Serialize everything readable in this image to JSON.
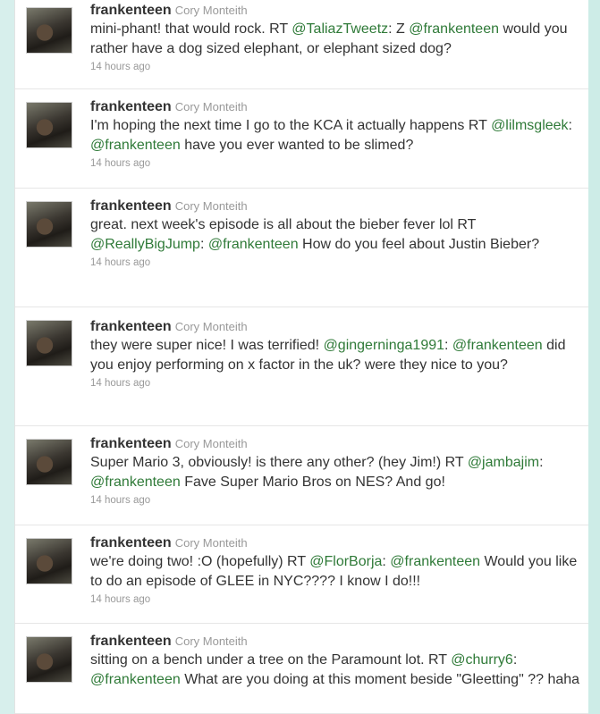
{
  "tweets": [
    {
      "screen_name": "frankenteen",
      "full_name": "Cory Monteith",
      "segments": [
        {
          "t": "mini-phant! that would rock. RT "
        },
        {
          "t": "@TaliazTweetz",
          "link": true
        },
        {
          "t": ": Z "
        },
        {
          "t": "@frankenteen",
          "link": true
        },
        {
          "t": " would you rather have a dog sized elephant, or elephant sized dog?"
        }
      ],
      "timestamp": "14 hours ago"
    },
    {
      "screen_name": "frankenteen",
      "full_name": "Cory Monteith",
      "segments": [
        {
          "t": "I'm hoping the next time I go to the KCA it actually happens RT "
        },
        {
          "t": "@lilmsgleek",
          "link": true
        },
        {
          "t": ": "
        },
        {
          "t": "@frankenteen",
          "link": true
        },
        {
          "t": " have you ever wanted to be slimed?"
        }
      ],
      "timestamp": "14 hours ago"
    },
    {
      "screen_name": "frankenteen",
      "full_name": "Cory Monteith",
      "segments": [
        {
          "t": "great. next week's episode is all about the bieber fever lol RT "
        },
        {
          "t": "@ReallyBigJump",
          "link": true
        },
        {
          "t": ": "
        },
        {
          "t": "@frankenteen",
          "link": true
        },
        {
          "t": " How do you feel about Justin Bieber?"
        }
      ],
      "timestamp": "14 hours ago"
    },
    {
      "screen_name": "frankenteen",
      "full_name": "Cory Monteith",
      "segments": [
        {
          "t": "they were super nice! I was terrified! "
        },
        {
          "t": "@gingerninga1991",
          "link": true
        },
        {
          "t": ": "
        },
        {
          "t": "@frankenteen",
          "link": true
        },
        {
          "t": " did you enjoy performing on x factor in the uk? were they nice to you?"
        }
      ],
      "timestamp": "14 hours ago"
    },
    {
      "screen_name": "frankenteen",
      "full_name": "Cory Monteith",
      "segments": [
        {
          "t": "Super Mario 3, obviously! is there any other? (hey Jim!) RT "
        },
        {
          "t": "@jambajim",
          "link": true
        },
        {
          "t": ": "
        },
        {
          "t": "@frankenteen",
          "link": true
        },
        {
          "t": " Fave Super Mario Bros on NES? And go!"
        }
      ],
      "timestamp": "14 hours ago"
    },
    {
      "screen_name": "frankenteen",
      "full_name": "Cory Monteith",
      "segments": [
        {
          "t": "we're doing two! :O (hopefully) RT "
        },
        {
          "t": "@FlorBorja",
          "link": true
        },
        {
          "t": ": "
        },
        {
          "t": "@frankenteen",
          "link": true
        },
        {
          "t": " Would you like to do an episode of GLEE in NYC???? I know I do!!!"
        }
      ],
      "timestamp": "14 hours ago"
    },
    {
      "screen_name": "frankenteen",
      "full_name": "Cory Monteith",
      "segments": [
        {
          "t": "sitting on a bench under a tree on the Paramount lot. RT "
        },
        {
          "t": "@churry6",
          "link": true
        },
        {
          "t": ": "
        },
        {
          "t": "@frankenteen",
          "link": true
        },
        {
          "t": " What are you doing at this moment beside \"Gleetting\" ?? haha"
        }
      ],
      "timestamp": ""
    }
  ]
}
